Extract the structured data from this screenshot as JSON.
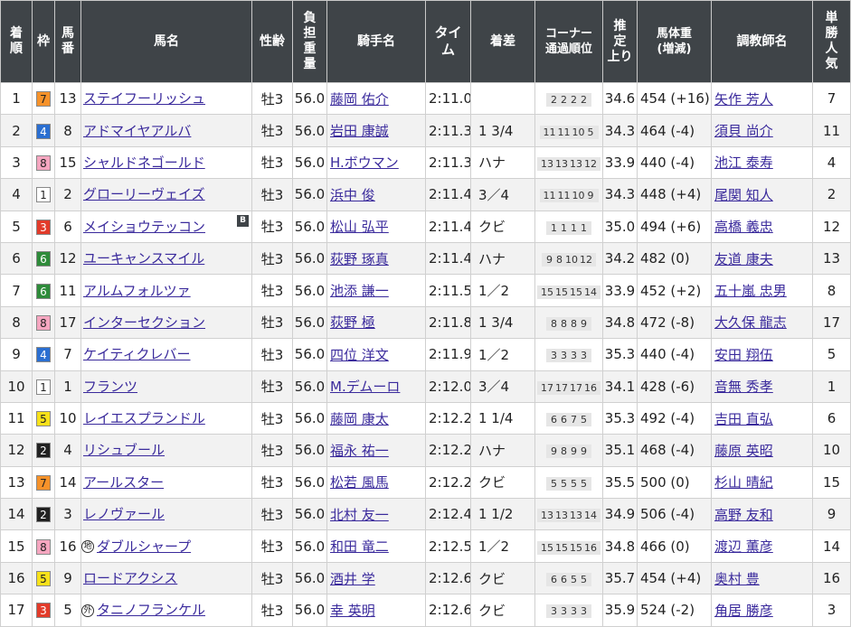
{
  "headers": {
    "rank": [
      "着",
      "順"
    ],
    "waku": "枠",
    "umaban": [
      "馬",
      "番"
    ],
    "horse": "馬名",
    "sexage": "性齢",
    "weight": [
      "負",
      "担",
      "重",
      "量"
    ],
    "jockey": "騎手名",
    "time": [
      "タイ",
      "ム"
    ],
    "margin": "着差",
    "corner": [
      "コーナー",
      "通過順位"
    ],
    "last3f": [
      "推",
      "定",
      "上り"
    ],
    "bodyweight": [
      "馬体重",
      "(増減)"
    ],
    "trainer": "調教師名",
    "pop": [
      "単",
      "勝",
      "人",
      "気"
    ]
  },
  "waku_colors": {
    "1": {
      "bg": "#ffffff",
      "fg": "#222222"
    },
    "2": {
      "bg": "#222222",
      "fg": "#ffffff"
    },
    "3": {
      "bg": "#e23b2a",
      "fg": "#ffffff"
    },
    "4": {
      "bg": "#2b6fd1",
      "fg": "#ffffff"
    },
    "5": {
      "bg": "#f7e11a",
      "fg": "#222222"
    },
    "6": {
      "bg": "#2e8b3a",
      "fg": "#ffffff"
    },
    "7": {
      "bg": "#f6922a",
      "fg": "#222222"
    },
    "8": {
      "bg": "#f6a6c0",
      "fg": "#222222"
    }
  },
  "rows": [
    {
      "rank": "1",
      "waku": "7",
      "umaban": "13",
      "mark": "",
      "horse": "ステイフーリッシュ",
      "blinker": false,
      "sexage": "牡3",
      "weight": "56.0",
      "jockey": "藤岡 佑介",
      "time": "2:11.0",
      "margin": "",
      "corner": [
        "2",
        "2",
        "2",
        "2"
      ],
      "last3f": "34.6",
      "bodyweight": "454 (+16)",
      "trainer": "矢作 芳人",
      "pop": "7"
    },
    {
      "rank": "2",
      "waku": "4",
      "umaban": "8",
      "mark": "",
      "horse": "アドマイヤアルバ",
      "blinker": false,
      "sexage": "牡3",
      "weight": "56.0",
      "jockey": "岩田 康誠",
      "time": "2:11.3",
      "margin": "1 3/4",
      "corner": [
        "11",
        "11",
        "10",
        "5"
      ],
      "last3f": "34.3",
      "bodyweight": "464 (-4)",
      "trainer": "須貝 尚介",
      "pop": "11"
    },
    {
      "rank": "3",
      "waku": "8",
      "umaban": "15",
      "mark": "",
      "horse": "シャルドネゴールド",
      "blinker": false,
      "sexage": "牡3",
      "weight": "56.0",
      "jockey": "H.ボウマン",
      "time": "2:11.3",
      "margin": "ハナ",
      "corner": [
        "13",
        "13",
        "13",
        "12"
      ],
      "last3f": "33.9",
      "bodyweight": "440 (-4)",
      "trainer": "池江 泰寿",
      "pop": "4"
    },
    {
      "rank": "4",
      "waku": "1",
      "umaban": "2",
      "mark": "",
      "horse": "グローリーヴェイズ",
      "blinker": false,
      "sexage": "牡3",
      "weight": "56.0",
      "jockey": "浜中 俊",
      "time": "2:11.4",
      "margin": "3／4",
      "corner": [
        "11",
        "11",
        "10",
        "9"
      ],
      "last3f": "34.3",
      "bodyweight": "448 (+4)",
      "trainer": "尾関 知人",
      "pop": "2"
    },
    {
      "rank": "5",
      "waku": "3",
      "umaban": "6",
      "mark": "",
      "horse": "メイショウテッコン",
      "blinker": true,
      "sexage": "牡3",
      "weight": "56.0",
      "jockey": "松山 弘平",
      "time": "2:11.4",
      "margin": "クビ",
      "corner": [
        "1",
        "1",
        "1",
        "1"
      ],
      "last3f": "35.0",
      "bodyweight": "494 (+6)",
      "trainer": "高橋 義忠",
      "pop": "12"
    },
    {
      "rank": "6",
      "waku": "6",
      "umaban": "12",
      "mark": "",
      "horse": "ユーキャンスマイル",
      "blinker": false,
      "sexage": "牡3",
      "weight": "56.0",
      "jockey": "荻野 琢真",
      "time": "2:11.4",
      "margin": "ハナ",
      "corner": [
        "9",
        "8",
        "10",
        "12"
      ],
      "last3f": "34.2",
      "bodyweight": "482 (0)",
      "trainer": "友道 康夫",
      "pop": "13"
    },
    {
      "rank": "7",
      "waku": "6",
      "umaban": "11",
      "mark": "",
      "horse": "アルムフォルツァ",
      "blinker": false,
      "sexage": "牡3",
      "weight": "56.0",
      "jockey": "池添 謙一",
      "time": "2:11.5",
      "margin": "1／2",
      "corner": [
        "15",
        "15",
        "15",
        "14"
      ],
      "last3f": "33.9",
      "bodyweight": "452 (+2)",
      "trainer": "五十嵐 忠男",
      "pop": "8"
    },
    {
      "rank": "8",
      "waku": "8",
      "umaban": "17",
      "mark": "",
      "horse": "インターセクション",
      "blinker": false,
      "sexage": "牡3",
      "weight": "56.0",
      "jockey": "荻野 極",
      "time": "2:11.8",
      "margin": "1 3/4",
      "corner": [
        "8",
        "8",
        "8",
        "9"
      ],
      "last3f": "34.8",
      "bodyweight": "472 (-8)",
      "trainer": "大久保 龍志",
      "pop": "17"
    },
    {
      "rank": "9",
      "waku": "4",
      "umaban": "7",
      "mark": "",
      "horse": "ケイティクレバー",
      "blinker": false,
      "sexage": "牡3",
      "weight": "56.0",
      "jockey": "四位 洋文",
      "time": "2:11.9",
      "margin": "1／2",
      "corner": [
        "3",
        "3",
        "3",
        "3"
      ],
      "last3f": "35.3",
      "bodyweight": "440 (-4)",
      "trainer": "安田 翔伍",
      "pop": "5"
    },
    {
      "rank": "10",
      "waku": "1",
      "umaban": "1",
      "mark": "",
      "horse": "フランツ",
      "blinker": false,
      "sexage": "牡3",
      "weight": "56.0",
      "jockey": "M.デムーロ",
      "time": "2:12.0",
      "margin": "3／4",
      "corner": [
        "17",
        "17",
        "17",
        "16"
      ],
      "last3f": "34.1",
      "bodyweight": "428 (-6)",
      "trainer": "音無 秀孝",
      "pop": "1"
    },
    {
      "rank": "11",
      "waku": "5",
      "umaban": "10",
      "mark": "",
      "horse": "レイエスプランドル",
      "blinker": false,
      "sexage": "牡3",
      "weight": "56.0",
      "jockey": "藤岡 康太",
      "time": "2:12.2",
      "margin": "1 1/4",
      "corner": [
        "6",
        "6",
        "7",
        "5"
      ],
      "last3f": "35.3",
      "bodyweight": "492 (-4)",
      "trainer": "吉田 直弘",
      "pop": "6"
    },
    {
      "rank": "12",
      "waku": "2",
      "umaban": "4",
      "mark": "",
      "horse": "リシュブール",
      "blinker": false,
      "sexage": "牡3",
      "weight": "56.0",
      "jockey": "福永 祐一",
      "time": "2:12.2",
      "margin": "ハナ",
      "corner": [
        "9",
        "8",
        "9",
        "9"
      ],
      "last3f": "35.1",
      "bodyweight": "468 (-4)",
      "trainer": "藤原 英昭",
      "pop": "10"
    },
    {
      "rank": "13",
      "waku": "7",
      "umaban": "14",
      "mark": "",
      "horse": "アールスター",
      "blinker": false,
      "sexage": "牡3",
      "weight": "56.0",
      "jockey": "松若 風馬",
      "time": "2:12.2",
      "margin": "クビ",
      "corner": [
        "5",
        "5",
        "5",
        "5"
      ],
      "last3f": "35.5",
      "bodyweight": "500 (0)",
      "trainer": "杉山 晴紀",
      "pop": "15"
    },
    {
      "rank": "14",
      "waku": "2",
      "umaban": "3",
      "mark": "",
      "horse": "レノヴァール",
      "blinker": false,
      "sexage": "牡3",
      "weight": "56.0",
      "jockey": "北村 友一",
      "time": "2:12.4",
      "margin": "1 1/2",
      "corner": [
        "13",
        "13",
        "13",
        "14"
      ],
      "last3f": "34.9",
      "bodyweight": "506 (-4)",
      "trainer": "高野 友和",
      "pop": "9"
    },
    {
      "rank": "15",
      "waku": "8",
      "umaban": "16",
      "mark": "地",
      "horse": "ダブルシャープ",
      "blinker": false,
      "sexage": "牡3",
      "weight": "56.0",
      "jockey": "和田 竜二",
      "time": "2:12.5",
      "margin": "1／2",
      "corner": [
        "15",
        "15",
        "15",
        "16"
      ],
      "last3f": "34.8",
      "bodyweight": "466 (0)",
      "trainer": "渡辺 薫彦",
      "pop": "14"
    },
    {
      "rank": "16",
      "waku": "5",
      "umaban": "9",
      "mark": "",
      "horse": "ロードアクシス",
      "blinker": false,
      "sexage": "牡3",
      "weight": "56.0",
      "jockey": "酒井 学",
      "time": "2:12.6",
      "margin": "クビ",
      "corner": [
        "6",
        "6",
        "5",
        "5"
      ],
      "last3f": "35.7",
      "bodyweight": "454 (+4)",
      "trainer": "奥村 豊",
      "pop": "16"
    },
    {
      "rank": "17",
      "waku": "3",
      "umaban": "5",
      "mark": "外",
      "horse": "タニノフランケル",
      "blinker": false,
      "sexage": "牡3",
      "weight": "56.0",
      "jockey": "幸 英明",
      "time": "2:12.6",
      "margin": "クビ",
      "corner": [
        "3",
        "3",
        "3",
        "3"
      ],
      "last3f": "35.9",
      "bodyweight": "524 (-2)",
      "trainer": "角居 勝彦",
      "pop": "3"
    }
  ]
}
